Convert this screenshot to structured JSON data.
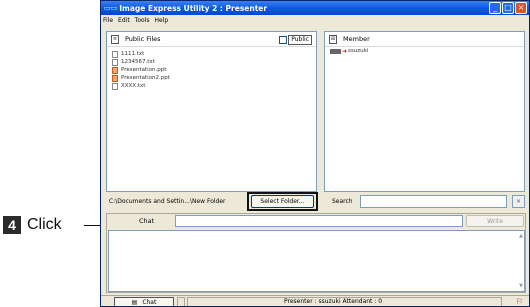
{
  "annotation": {
    "step_number": "4",
    "step_text": "Click"
  },
  "window": {
    "title": "Image Express Utility 2 : Presenter",
    "buttons": [
      "_",
      "□",
      "×"
    ]
  },
  "menu": [
    "File",
    "Edit",
    "Tools",
    "Help"
  ],
  "public_files": {
    "header": "Public Files",
    "public_checkbox_label": "Public",
    "public_checked": false,
    "files": [
      {
        "name": "1111.txt",
        "type": "txt"
      },
      {
        "name": "1234567.txt",
        "type": "txt"
      },
      {
        "name": "Presentation.ppt",
        "type": "ppt"
      },
      {
        "name": "Presentation2.ppt",
        "type": "ppt"
      },
      {
        "name": "XXXX.txt",
        "type": "txt"
      }
    ]
  },
  "member": {
    "header": "Member",
    "members": [
      "ssuzuki"
    ]
  },
  "folder": {
    "path": "C:\\Documents and Settin...\\New Folder",
    "select_button": "Select Folder..."
  },
  "search": {
    "label": "Search",
    "value": "",
    "clear_button": "×"
  },
  "chat": {
    "label": "Chat",
    "input_value": "",
    "write_button": "Write"
  },
  "status": {
    "chat_button": "Chat",
    "presenter_text": "Presenter : ssuzuki   Attendant : 0"
  },
  "colors": {
    "titlebar": "#0054e3",
    "window_bg": "#ece9d8",
    "highlight_border": "#111111"
  }
}
